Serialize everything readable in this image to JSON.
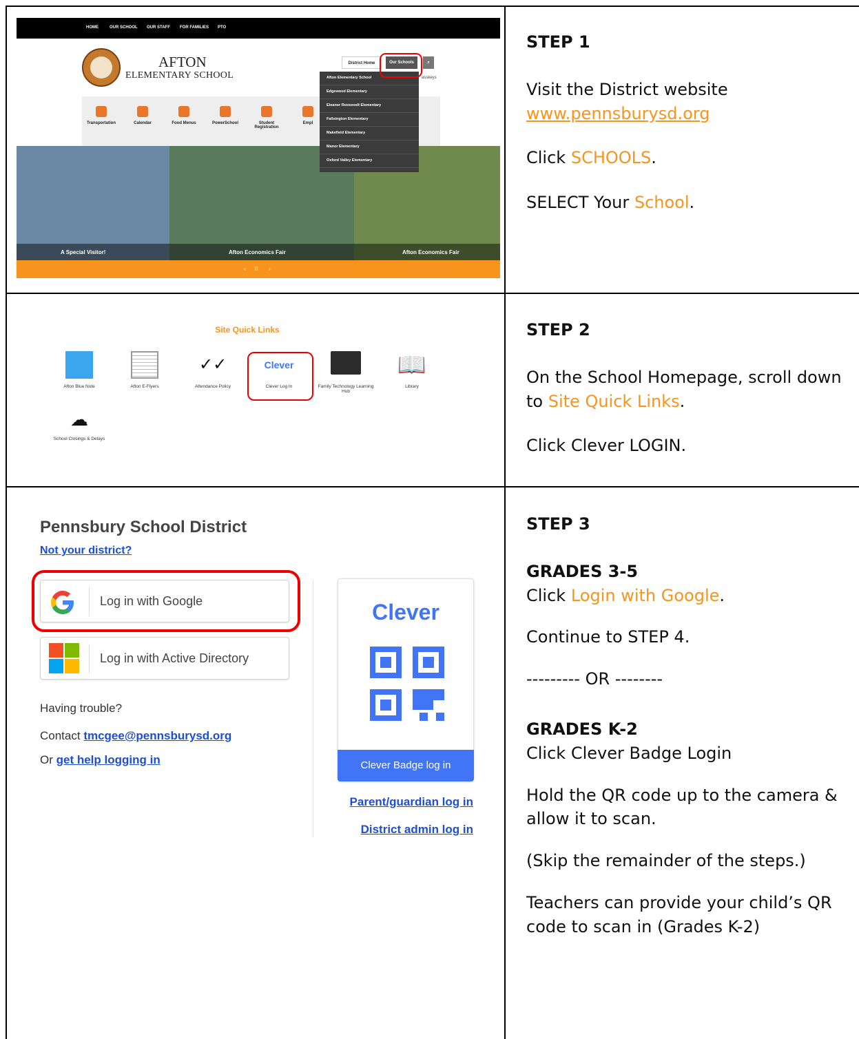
{
  "step1": {
    "heading": "STEP 1",
    "line1": "Visit the District website",
    "url": "www.pennsburysd.org",
    "click_pre": "Click ",
    "click_word": "SCHOOLS",
    "click_post": ".",
    "select_pre": "SELECT Your ",
    "select_word": "School",
    "select_post": "."
  },
  "step2": {
    "heading": "STEP 2",
    "line1_pre": "On the School Homepage, scroll down to ",
    "line1_link": "Site Quick Links",
    "line1_post": ".",
    "line2": "Click Clever LOGIN."
  },
  "step3": {
    "heading": "STEP 3",
    "grades_a": "GRADES 3-5",
    "click_pre": "Click ",
    "click_word": "Login with Google",
    "click_post": ".",
    "continue": "Continue to STEP 4.",
    "or": "--------- OR --------",
    "grades_b": "GRADES K-2",
    "badge_line": "Click Clever Badge Login",
    "hold": "Hold the QR code up to the camera & allow it to scan.",
    "skip": "(Skip the remainder of the steps.)",
    "teachers": "Teachers can provide your child’s QR code to scan in (Grades K-2)"
  },
  "school_site": {
    "top_nav": [
      "HOME",
      "OUR SCHOOL",
      "OUR STAFF",
      "FOR FAMILIES",
      "PTO"
    ],
    "name_line1": "AFTON",
    "name_line2": "ELEMENTARY SCHOOL",
    "district_home": "District Home",
    "our_schools": "Our Schools",
    "passkeys": "asskeys",
    "quick": [
      "Transportation",
      "Calendar",
      "Food Menus",
      "PowerSchool",
      "Student Registration",
      "Empl"
    ],
    "dropdown": [
      "Afton Elementary School",
      "Edgewood Elementary",
      "Eleanor Roosevelt Elementary",
      "Fallsington Elementary",
      "Makefield Elementary",
      "Manor Elementary",
      "Oxford Valley Elementary"
    ],
    "captions": [
      "A Special Visitor!",
      "Afton Economics Fair",
      "Afton Economics Fair"
    ],
    "controls": [
      "‹",
      "II",
      "›"
    ],
    "colors": {
      "accent": "#f7941d",
      "dark": "#000000",
      "dropdown": "#3b3b3b"
    }
  },
  "quick_links": {
    "title": "Site Quick Links",
    "clever_logo": "Clever",
    "items": [
      "Afton Blue Note",
      "Afton E-Flyers",
      "Attendance Policy",
      "Clever Log In",
      "Family Technology Learning Hub",
      "Library",
      "School Closings & Delays"
    ]
  },
  "clever_login": {
    "district": "Pennsbury School District",
    "not_your": "Not your district?",
    "google": "Log in with Google",
    "active_dir": "Log in with Active Directory",
    "trouble": "Having trouble?",
    "contact_pre": "Contact ",
    "contact_email": "tmcgee@pennsburysd.org",
    "or_pre": "Or ",
    "help": "get help logging in",
    "brand": "Clever",
    "badge_btn": "Clever Badge log in",
    "parent": "Parent/guardian log in",
    "admin": "District admin log in",
    "colors": {
      "clever_blue": "#4274f6",
      "link": "#1d4ed8"
    }
  }
}
